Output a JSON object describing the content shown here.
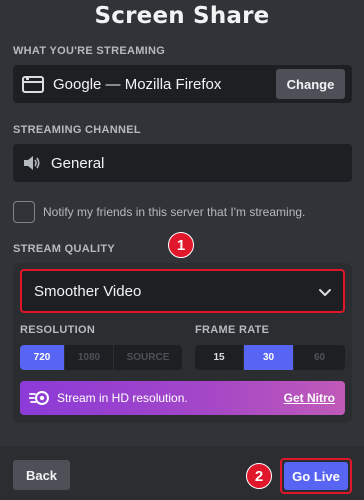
{
  "dialog": {
    "title": "Screen Share"
  },
  "streaming": {
    "label": "WHAT YOU'RE STREAMING",
    "source": "Google — Mozilla Firefox",
    "source_icon": "window-icon",
    "change_label": "Change"
  },
  "channel": {
    "label": "STREAMING CHANNEL",
    "name": "General",
    "icon": "speaker-icon"
  },
  "notify": {
    "label": "Notify my friends in this server that I'm streaming.",
    "checked": false
  },
  "quality": {
    "label": "STREAM QUALITY",
    "preset": "Smoother Video",
    "resolution_label": "RESOLUTION",
    "resolution_options": [
      "720",
      "1080",
      "SOURCE"
    ],
    "resolution_selected": "720",
    "framerate_label": "FRAME RATE",
    "framerate_options": [
      "15",
      "30",
      "60"
    ],
    "framerate_selected": "30",
    "nitro_text": "Stream in HD resolution.",
    "nitro_link": "Get Nitro"
  },
  "footer": {
    "back_label": "Back",
    "go_live_label": "Go Live"
  },
  "annotations": {
    "badge_1": "1",
    "badge_2": "2"
  },
  "colors": {
    "accent": "#5865f2",
    "highlight": "#e0162b",
    "background": "#313338"
  }
}
